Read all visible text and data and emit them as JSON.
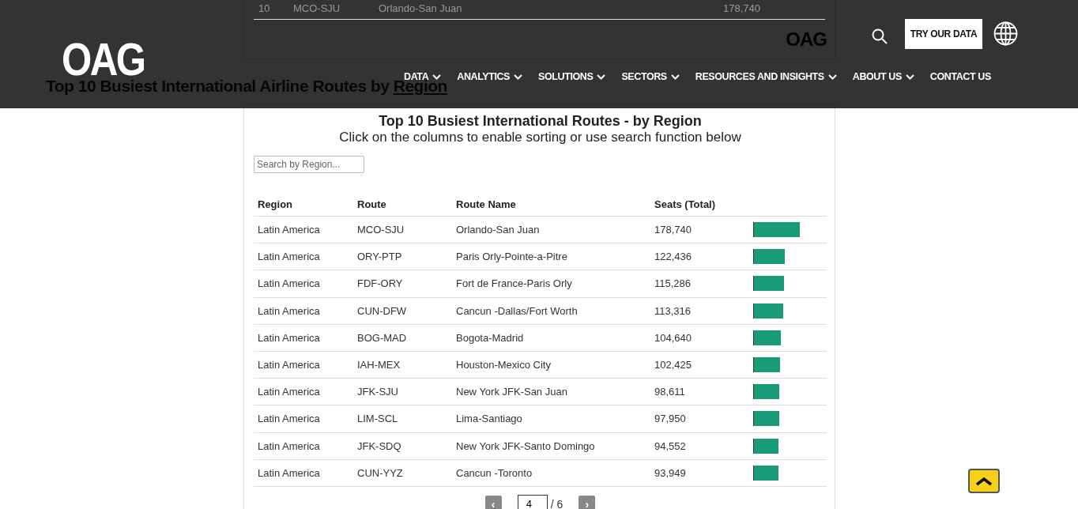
{
  "background_table_row": {
    "rank": "10",
    "route": "MCO-SJU",
    "route_name": "Orlando-San Juan",
    "seats": "178,740"
  },
  "embed_logo": "OAG",
  "page_heading": {
    "text": "Top 10 Busiest International Airline Routes by ",
    "link": "Region"
  },
  "header": {
    "logo": "OAG",
    "try_button": "TRY OUR DATA",
    "nav": [
      {
        "label": "DATA",
        "dropdown": true
      },
      {
        "label": "ANALYTICS",
        "dropdown": true
      },
      {
        "label": "SOLUTIONS",
        "dropdown": true
      },
      {
        "label": "SECTORS",
        "dropdown": true
      },
      {
        "label": "RESOURCES AND INSIGHTS",
        "dropdown": true
      },
      {
        "label": "ABOUT US",
        "dropdown": true
      },
      {
        "label": "CONTACT US",
        "dropdown": false
      }
    ]
  },
  "table_card": {
    "title": "Top 10 Busiest International Routes - by Region",
    "subtitle": "Click on the columns to enable sorting or use search function below",
    "search": {
      "placeholder": "Search by Region..."
    },
    "columns": [
      "Region",
      "Route",
      "Route Name",
      "Seats (Total)"
    ],
    "rows": [
      {
        "region": "Latin America",
        "route": "MCO-SJU",
        "route_name": "Orlando-San Juan",
        "seats": "178,740",
        "level": 0.62
      },
      {
        "region": "Latin America",
        "route": "ORY-PTP",
        "route_name": "Paris Orly-Pointe-a-Pitre",
        "seats": "122,436",
        "level": 0.42
      },
      {
        "region": "Latin America",
        "route": "FDF-ORY",
        "route_name": "Fort de France-Paris Orly",
        "seats": "115,286",
        "level": 0.4
      },
      {
        "region": "Latin America",
        "route": "CUN-DFW",
        "route_name": "Cancun -Dallas/Fort Worth",
        "seats": "113,316",
        "level": 0.39
      },
      {
        "region": "Latin America",
        "route": "BOG-MAD",
        "route_name": "Bogota-Madrid",
        "seats": "104,640",
        "level": 0.36
      },
      {
        "region": "Latin America",
        "route": "IAH-MEX",
        "route_name": "Houston-Mexico City",
        "seats": "102,425",
        "level": 0.35
      },
      {
        "region": "Latin America",
        "route": "JFK-SJU",
        "route_name": "New York JFK-San Juan",
        "seats": "98,611",
        "level": 0.34
      },
      {
        "region": "Latin America",
        "route": "LIM-SCL",
        "route_name": "Lima-Santiago",
        "seats": "97,950",
        "level": 0.34
      },
      {
        "region": "Latin America",
        "route": "JFK-SDQ",
        "route_name": "New York JFK-Santo Domingo",
        "seats": "94,552",
        "level": 0.33
      },
      {
        "region": "Latin America",
        "route": "CUN-YYZ",
        "route_name": "Cancun -Toronto",
        "seats": "93,949",
        "level": 0.33
      }
    ],
    "pager": {
      "prev": "‹",
      "page": "4",
      "total": "/ 6",
      "next": "›"
    }
  }
}
